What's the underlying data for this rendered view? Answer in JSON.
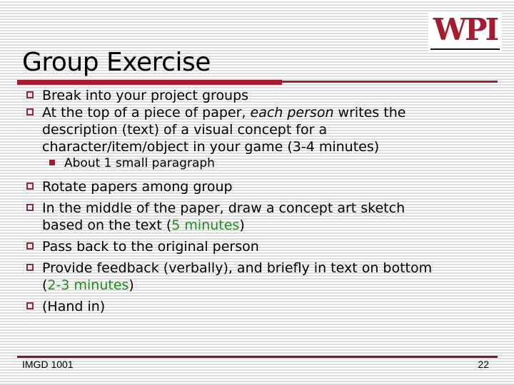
{
  "colors": {
    "accent": "#a51c30",
    "bullet_border": "#8b2a3c",
    "highlight": "#1e8b1e",
    "footer_rule": "#7a1c2e"
  },
  "logo": {
    "text": "WPI",
    "icon": "wpi-logo"
  },
  "slide": {
    "title": "Group Exercise",
    "bullets": [
      {
        "segments": [
          {
            "text": "Break into your project groups"
          }
        ]
      },
      {
        "lines": [
          [
            {
              "text": "At the top of a piece of paper, "
            },
            {
              "text": "each person",
              "style": "italic"
            },
            {
              "text": " writes the"
            }
          ],
          [
            {
              "text": "description (text) of a visual concept for a"
            }
          ],
          [
            {
              "text": "character/item/object in your game (3-4 minutes)"
            }
          ]
        ],
        "sub_bullets": [
          {
            "text": "About 1 small paragraph"
          }
        ]
      },
      {
        "segments": [
          {
            "text": "Rotate papers among group"
          }
        ]
      },
      {
        "lines": [
          [
            {
              "text": "In the middle of the paper, draw a concept art sketch"
            }
          ],
          [
            {
              "text": "based on the text ("
            },
            {
              "text": "5 minutes",
              "style": "green"
            },
            {
              "text": ")"
            }
          ]
        ]
      },
      {
        "segments": [
          {
            "text": "Pass back to the original person"
          }
        ]
      },
      {
        "lines": [
          [
            {
              "text": "Provide feedback (verbally), and briefly in text on bottom"
            }
          ],
          [
            {
              "text": "("
            },
            {
              "text": "2-3 minutes",
              "style": "green"
            },
            {
              "text": ")"
            }
          ]
        ]
      },
      {
        "segments": [
          {
            "text": "(Hand in)"
          }
        ]
      }
    ]
  },
  "footer": {
    "course": "IMGD 1001",
    "page_number": "22"
  }
}
